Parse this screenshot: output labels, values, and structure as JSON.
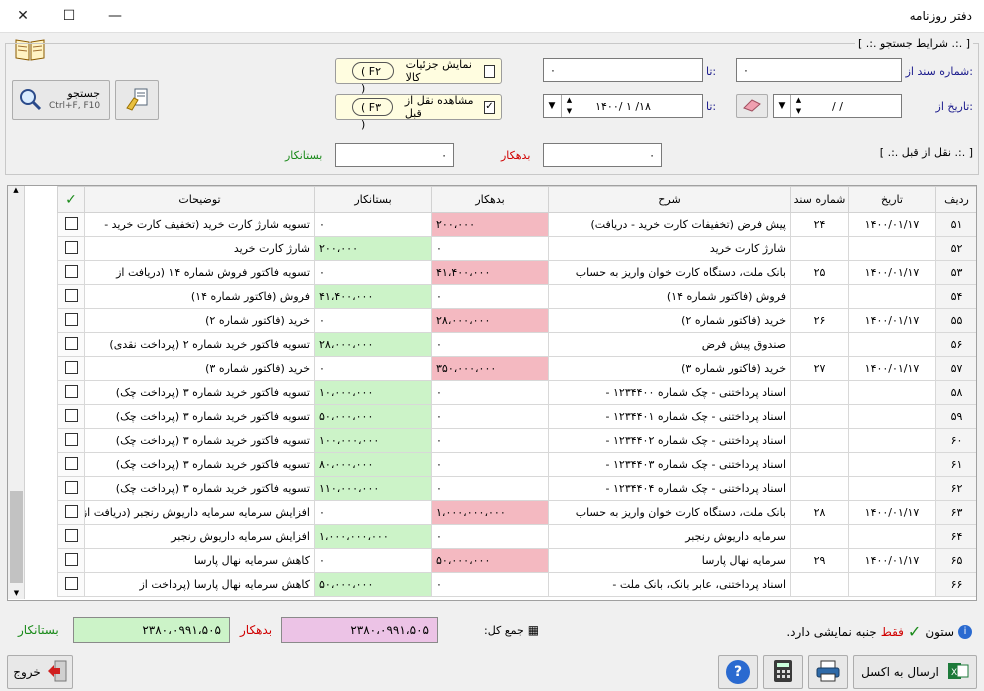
{
  "window": {
    "title": "دفتر روزنامه"
  },
  "search": {
    "legend": "[ .:. شرایط جستجو .:. ]",
    "doc_from_label": "شماره سند از:",
    "doc_from_value": "۰",
    "doc_to_label": "تا:",
    "doc_to_value": "۰",
    "date_from_label": "تاریخ از:",
    "date_from_value": "/    /",
    "date_to_label": "تا:",
    "date_to_value": "۱۴۰۰/ ۱ /۱۸",
    "show_details_label": "نمایش جزئیات کالا",
    "show_details_key": "( F۲ )",
    "show_prev_label": "مشاهده نقل از قبل",
    "show_prev_key": "( F۳ )",
    "search_button": "جستجو",
    "search_shortcut": "Ctrl+F, F10",
    "prev_legend": "[ .:. نقل از قبل .:. ]",
    "prev_debit_label": "بدهکار",
    "prev_debit_value": "۰",
    "prev_credit_label": "بستانکار",
    "prev_credit_value": "۰"
  },
  "table": {
    "headers": [
      "ردیف",
      "تاریخ",
      "شماره سند",
      "شرح",
      "بدهکار",
      "بستانکار",
      "توضیحات"
    ],
    "check_header": "✓",
    "rows": [
      {
        "id": "۵۱",
        "date": "۱۴۰۰/۰۱/۱۷",
        "doc": "۲۴",
        "desc": "پیش فرض (تخفیفات کارت خرید - دریافت)",
        "debit": "۲۰۰،۰۰۰",
        "credit": "۰",
        "note": "تسویه شارژ کارت خرید (تخفیف کارت خرید -"
      },
      {
        "id": "۵۲",
        "date": "",
        "doc": "",
        "desc": "شارژ کارت خرید",
        "debit": "۰",
        "credit": "۲۰۰،۰۰۰",
        "note": "شارژ کارت خرید"
      },
      {
        "id": "۵۳",
        "date": "۱۴۰۰/۰۱/۱۷",
        "doc": "۲۵",
        "desc": "بانک ملت، دستگاه کارت خوان واریز به حساب",
        "debit": "۴۱،۴۰۰،۰۰۰",
        "credit": "۰",
        "note": "تسویه فاکتور فروش شماره ۱۴ (دریافت از"
      },
      {
        "id": "۵۴",
        "date": "",
        "doc": "",
        "desc": "فروش (فاکتور شماره ۱۴)",
        "debit": "۰",
        "credit": "۴۱،۴۰۰،۰۰۰",
        "note": "فروش (فاکتور شماره ۱۴)"
      },
      {
        "id": "۵۵",
        "date": "۱۴۰۰/۰۱/۱۷",
        "doc": "۲۶",
        "desc": "خرید (فاکتور شماره ۲)",
        "debit": "۲۸،۰۰۰،۰۰۰",
        "credit": "۰",
        "note": "خرید (فاکتور شماره ۲)"
      },
      {
        "id": "۵۶",
        "date": "",
        "doc": "",
        "desc": "صندوق پیش فرض",
        "debit": "۰",
        "credit": "۲۸،۰۰۰،۰۰۰",
        "note": "تسویه فاکتور خرید شماره ۲ (پرداخت نقدی)"
      },
      {
        "id": "۵۷",
        "date": "۱۴۰۰/۰۱/۱۷",
        "doc": "۲۷",
        "desc": "خرید (فاکتور شماره ۳)",
        "debit": "۳۵۰،۰۰۰،۰۰۰",
        "credit": "۰",
        "note": "خرید (فاکتور شماره ۳)"
      },
      {
        "id": "۵۸",
        "date": "",
        "doc": "",
        "desc": "اسناد پرداختنی - چک شماره ۱۲۳۴۴۰۰ -",
        "debit": "۰",
        "credit": "۱۰،۰۰۰،۰۰۰",
        "note": "تسویه فاکتور خرید شماره ۳ (پرداخت چک)"
      },
      {
        "id": "۵۹",
        "date": "",
        "doc": "",
        "desc": "اسناد پرداختنی - چک شماره ۱۲۳۴۴۰۱ -",
        "debit": "۰",
        "credit": "۵۰،۰۰۰،۰۰۰",
        "note": "تسویه فاکتور خرید شماره ۳ (پرداخت چک)"
      },
      {
        "id": "۶۰",
        "date": "",
        "doc": "",
        "desc": "اسناد پرداختنی - چک شماره ۱۲۳۴۴۰۲ -",
        "debit": "۰",
        "credit": "۱۰۰،۰۰۰،۰۰۰",
        "note": "تسویه فاکتور خرید شماره ۳ (پرداخت چک)"
      },
      {
        "id": "۶۱",
        "date": "",
        "doc": "",
        "desc": "اسناد پرداختنی - چک شماره ۱۲۳۴۴۰۳ -",
        "debit": "۰",
        "credit": "۸۰،۰۰۰،۰۰۰",
        "note": "تسویه فاکتور خرید شماره ۳ (پرداخت چک)"
      },
      {
        "id": "۶۲",
        "date": "",
        "doc": "",
        "desc": "اسناد پرداختنی - چک شماره ۱۲۳۴۴۰۴ -",
        "debit": "۰",
        "credit": "۱۱۰،۰۰۰،۰۰۰",
        "note": "تسویه فاکتور خرید شماره ۳ (پرداخت چک)"
      },
      {
        "id": "۶۳",
        "date": "۱۴۰۰/۰۱/۱۷",
        "doc": "۲۸",
        "desc": "بانک ملت، دستگاه کارت خوان واریز به حساب",
        "debit": "۱،۰۰۰،۰۰۰،۰۰۰",
        "credit": "۰",
        "note": "افزایش سرمایه سرمایه داریوش رنجبر (دریافت از"
      },
      {
        "id": "۶۴",
        "date": "",
        "doc": "",
        "desc": "سرمایه داریوش رنجبر",
        "debit": "۰",
        "credit": "۱،۰۰۰،۰۰۰،۰۰۰",
        "note": "افزایش سرمایه داریوش رنجبر"
      },
      {
        "id": "۶۵",
        "date": "۱۴۰۰/۰۱/۱۷",
        "doc": "۲۹",
        "desc": "سرمایه نهال پارسا",
        "debit": "۵۰،۰۰۰،۰۰۰",
        "credit": "۰",
        "note": "کاهش سرمایه نهال پارسا"
      },
      {
        "id": "۶۶",
        "date": "",
        "doc": "",
        "desc": "اسناد پرداختنی،  عابر بانک،  بانک ملت -",
        "debit": "۰",
        "credit": "۵۰،۰۰۰،۰۰۰",
        "note": "کاهش سرمایه نهال پارسا (پرداخت از"
      }
    ]
  },
  "footer": {
    "column_hint_prefix": "ستون",
    "column_hint_mid": "فقط",
    "column_hint_suffix": "جنبه نمایشی دارد.",
    "total_label": "جمع کل:",
    "debit_label": "بدهکار",
    "debit_total": "۲۳۸۰،۰۹۹۱،۵۰۵",
    "credit_label": "بستانکار",
    "credit_total": "۲۳۸۰،۰۹۹۱،۵۰۵",
    "excel_button": "ارسال به اکسل",
    "exit_button": "خروج",
    "help_symbol": "?"
  }
}
